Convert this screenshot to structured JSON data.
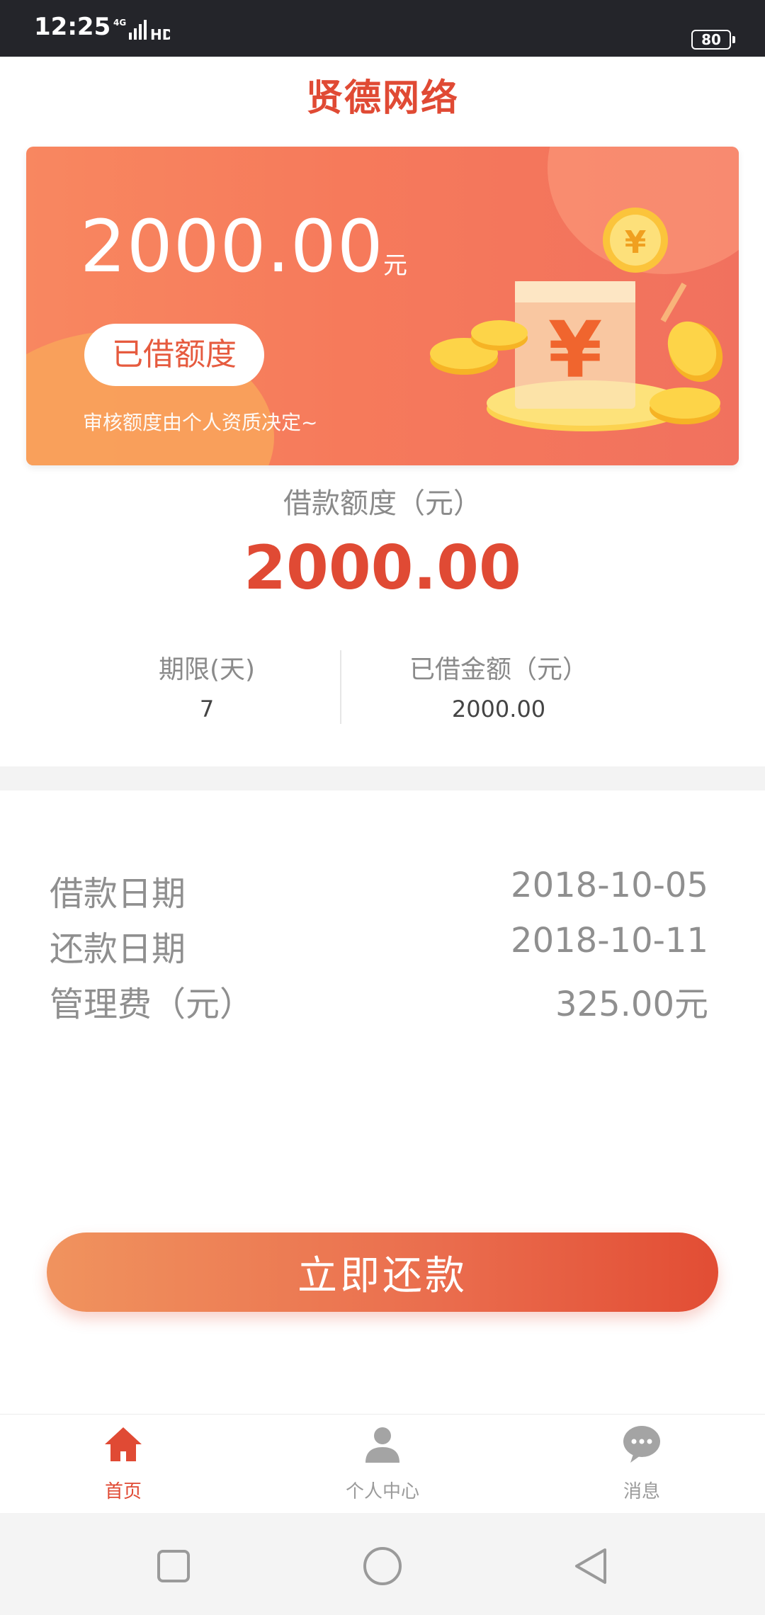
{
  "status_bar": {
    "time": "12:25",
    "network": "4G",
    "hd": "HD",
    "battery": "80"
  },
  "header": {
    "title": "贤德网络"
  },
  "banner": {
    "amount": "2000.00",
    "unit": "元",
    "pill_label": "已借额度",
    "note": "审核额度由个人资质决定~",
    "illustration": "coin-money-box-icon"
  },
  "quota": {
    "label": "借款额度（元）",
    "value": "2000.00",
    "term_label": "期限(天)",
    "term_value": "7",
    "borrowed_label": "已借金额（元）",
    "borrowed_value": "2000.00"
  },
  "details": [
    {
      "key": "借款日期",
      "value": "2018-10-05"
    },
    {
      "key": "还款日期",
      "value": "2018-10-11"
    },
    {
      "key": "管理费（元）",
      "value": "325.00元"
    }
  ],
  "actions": {
    "repay_label": "立即还款"
  },
  "tabbar": {
    "items": [
      {
        "label": "首页",
        "icon": "home-icon",
        "active": true
      },
      {
        "label": "个人中心",
        "icon": "user-icon",
        "active": false
      },
      {
        "label": "消息",
        "icon": "message-icon",
        "active": false
      }
    ]
  },
  "colors": {
    "accent": "#e04a34",
    "banner_start": "#f88760",
    "banner_end": "#f1715e",
    "muted_text": "#8a8a8a"
  }
}
